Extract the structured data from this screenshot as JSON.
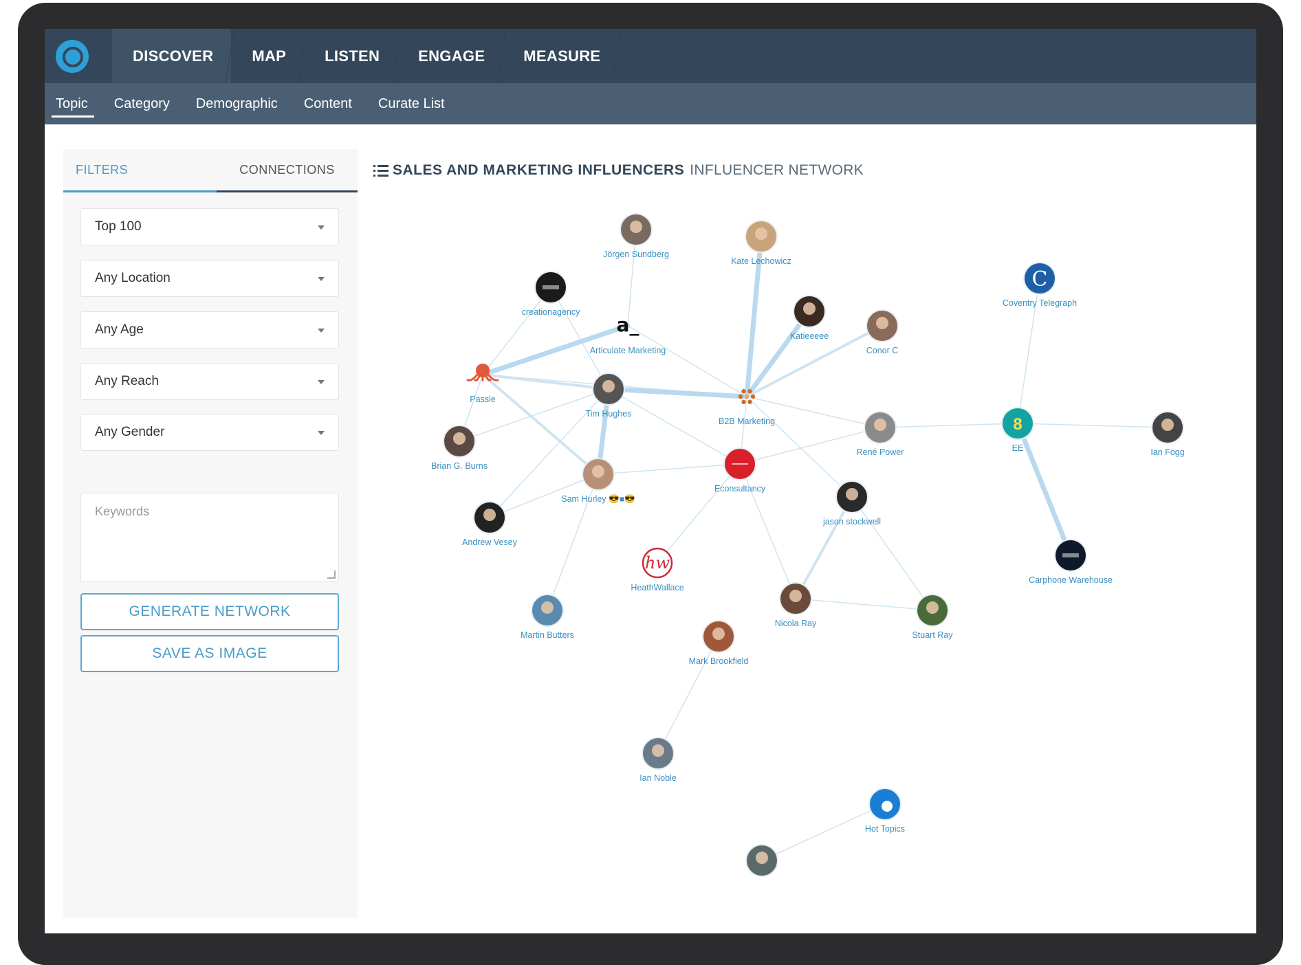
{
  "nav": {
    "logo": "logo-icon",
    "items": [
      {
        "label": "DISCOVER",
        "active": true
      },
      {
        "label": "MAP",
        "active": false
      },
      {
        "label": "LISTEN",
        "active": false
      },
      {
        "label": "ENGAGE",
        "active": false
      },
      {
        "label": "MEASURE",
        "active": false
      }
    ]
  },
  "subnav": {
    "items": [
      {
        "label": "Topic",
        "active": true
      },
      {
        "label": "Category",
        "active": false
      },
      {
        "label": "Demographic",
        "active": false
      },
      {
        "label": "Content",
        "active": false
      },
      {
        "label": "Curate List",
        "active": false
      }
    ]
  },
  "panel": {
    "tabs": [
      {
        "label": "FILTERS",
        "active": true
      },
      {
        "label": "CONNECTIONS",
        "active": false
      }
    ],
    "filters": [
      {
        "value": "Top 100"
      },
      {
        "value": "Any Location"
      },
      {
        "value": "Any Age"
      },
      {
        "value": "Any Reach"
      },
      {
        "value": "Any Gender"
      }
    ],
    "keywords_placeholder": "Keywords",
    "generate_label": "GENERATE NETWORK",
    "save_label": "SAVE AS IMAGE"
  },
  "main": {
    "title_bold": "SALES AND MARKETING INFLUENCERS",
    "title_light": "INFLUENCER NETWORK"
  },
  "network": {
    "colors": {
      "edge": "#cfe4f1",
      "edge_strong": "#b9d9ee",
      "label": "#3a8fc0"
    },
    "nodes": [
      {
        "id": "jorgen",
        "label": "Jörgen Sundberg",
        "icon": "person-avatar",
        "color": "#7a6a60"
      },
      {
        "id": "kate",
        "label": "Kate Lechowicz",
        "icon": "person-avatar",
        "color": "#c9a47a"
      },
      {
        "id": "creation",
        "label": "creationagency",
        "icon": "brand-logo",
        "color": "#1a1a1a"
      },
      {
        "id": "articulate",
        "label": "Articulate Marketing",
        "icon": "brand-logo",
        "color": "#111111"
      },
      {
        "id": "katieeeee",
        "label": "Katieeeee",
        "icon": "person-avatar",
        "color": "#3a2a22"
      },
      {
        "id": "conor",
        "label": "Conor C",
        "icon": "person-avatar",
        "color": "#8a6a58"
      },
      {
        "id": "coventry",
        "label": "Coventry Telegraph",
        "icon": "brand-logo",
        "color": "#1f5fa8"
      },
      {
        "id": "passle",
        "label": "Passle",
        "icon": "octopus-logo",
        "color": "#e0573a"
      },
      {
        "id": "tim",
        "label": "Tim Hughes",
        "icon": "person-avatar",
        "color": "#555555"
      },
      {
        "id": "b2b",
        "label": "B2B Marketing",
        "icon": "dots-logo",
        "color": "#d2691e"
      },
      {
        "id": "rene",
        "label": "René Power",
        "icon": "person-avatar",
        "color": "#8a8a8a"
      },
      {
        "id": "ee",
        "label": "EE",
        "icon": "brand-logo",
        "color": "#14a3a3"
      },
      {
        "id": "ianfogg",
        "label": "Ian Fogg",
        "icon": "person-avatar",
        "color": "#444444"
      },
      {
        "id": "brian",
        "label": "Brian G. Burns",
        "icon": "person-avatar",
        "color": "#5a4a42"
      },
      {
        "id": "sam",
        "label": "Sam Hurley 😎■😎",
        "icon": "person-avatar",
        "color": "#b89078"
      },
      {
        "id": "econsultancy",
        "label": "Econsultancy",
        "icon": "brand-logo",
        "color": "#d9202a"
      },
      {
        "id": "jason",
        "label": "jason stockwell",
        "icon": "person-avatar",
        "color": "#2a2a2a"
      },
      {
        "id": "andrew",
        "label": "Andrew Vesey",
        "icon": "person-avatar",
        "color": "#222222"
      },
      {
        "id": "heath",
        "label": "HeathWallace",
        "icon": "hw-logo",
        "color": "#cc2a3a"
      },
      {
        "id": "carphone",
        "label": "Carphone Warehouse",
        "icon": "brand-logo",
        "color": "#0e1a2a"
      },
      {
        "id": "martin",
        "label": "Martin Butters",
        "icon": "person-avatar",
        "color": "#5a8ab0"
      },
      {
        "id": "nicola",
        "label": "Nicola Ray",
        "icon": "person-avatar",
        "color": "#6a4a3a"
      },
      {
        "id": "stuart",
        "label": "Stuart Ray",
        "icon": "person-avatar",
        "color": "#4a6a3a"
      },
      {
        "id": "mark",
        "label": "Mark Brookfield",
        "icon": "person-avatar",
        "color": "#a0583a"
      },
      {
        "id": "iannoble",
        "label": "Ian Noble",
        "icon": "person-avatar",
        "color": "#6a7a8a"
      },
      {
        "id": "hottopics",
        "label": "Hot Topics",
        "icon": "brand-logo",
        "color": "#1a7fd4"
      },
      {
        "id": "unlabeled",
        "label": "",
        "icon": "person-avatar",
        "color": "#5a6a6a"
      }
    ],
    "edges": [
      [
        "jorgen",
        "articulate",
        1
      ],
      [
        "kate",
        "b2b",
        3
      ],
      [
        "creation",
        "passle",
        1
      ],
      [
        "creation",
        "tim",
        1
      ],
      [
        "articulate",
        "passle",
        3
      ],
      [
        "articulate",
        "b2b",
        1
      ],
      [
        "katieeeee",
        "b2b",
        3
      ],
      [
        "conor",
        "b2b",
        2
      ],
      [
        "coventry",
        "ee",
        1
      ],
      [
        "passle",
        "tim",
        2
      ],
      [
        "passle",
        "sam",
        2
      ],
      [
        "passle",
        "brian",
        1
      ],
      [
        "passle",
        "b2b",
        1
      ],
      [
        "tim",
        "b2b",
        3
      ],
      [
        "tim",
        "sam",
        3
      ],
      [
        "tim",
        "econsultancy",
        1
      ],
      [
        "tim",
        "andrew",
        1
      ],
      [
        "tim",
        "brian",
        1
      ],
      [
        "b2b",
        "rene",
        1
      ],
      [
        "b2b",
        "econsultancy",
        1
      ],
      [
        "b2b",
        "jason",
        1
      ],
      [
        "rene",
        "ee",
        1
      ],
      [
        "rene",
        "econsultancy",
        1
      ],
      [
        "ee",
        "ianfogg",
        1
      ],
      [
        "ee",
        "carphone",
        3
      ],
      [
        "sam",
        "econsultancy",
        1
      ],
      [
        "sam",
        "martin",
        1
      ],
      [
        "sam",
        "andrew",
        1
      ],
      [
        "econsultancy",
        "heath",
        1
      ],
      [
        "econsultancy",
        "nicola",
        1
      ],
      [
        "jason",
        "nicola",
        2
      ],
      [
        "jason",
        "stuart",
        1
      ],
      [
        "nicola",
        "stuart",
        1
      ],
      [
        "mark",
        "iannoble",
        1
      ],
      [
        "hottopics",
        "unlabeled",
        1
      ]
    ]
  }
}
